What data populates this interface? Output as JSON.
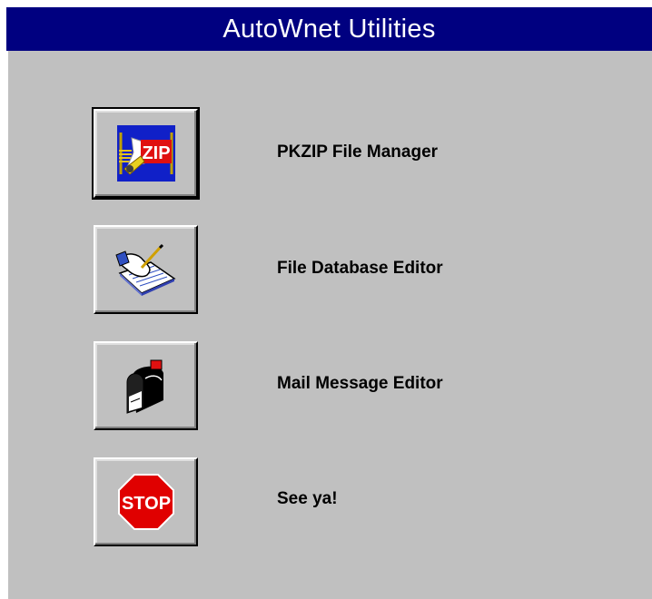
{
  "window": {
    "title": "AutoWnet Utilities"
  },
  "buttons": [
    {
      "label": "PKZIP File Manager",
      "icon": "zip-icon"
    },
    {
      "label": "File Database Editor",
      "icon": "writing-hand-icon"
    },
    {
      "label": "Mail Message Editor",
      "icon": "mailbox-icon"
    },
    {
      "label": "See ya!",
      "icon": "stop-sign-icon",
      "icon_text": "STOP"
    }
  ],
  "colors": {
    "titlebar": "#000080",
    "face": "#c0c0c0",
    "stop_red": "#e00000"
  }
}
